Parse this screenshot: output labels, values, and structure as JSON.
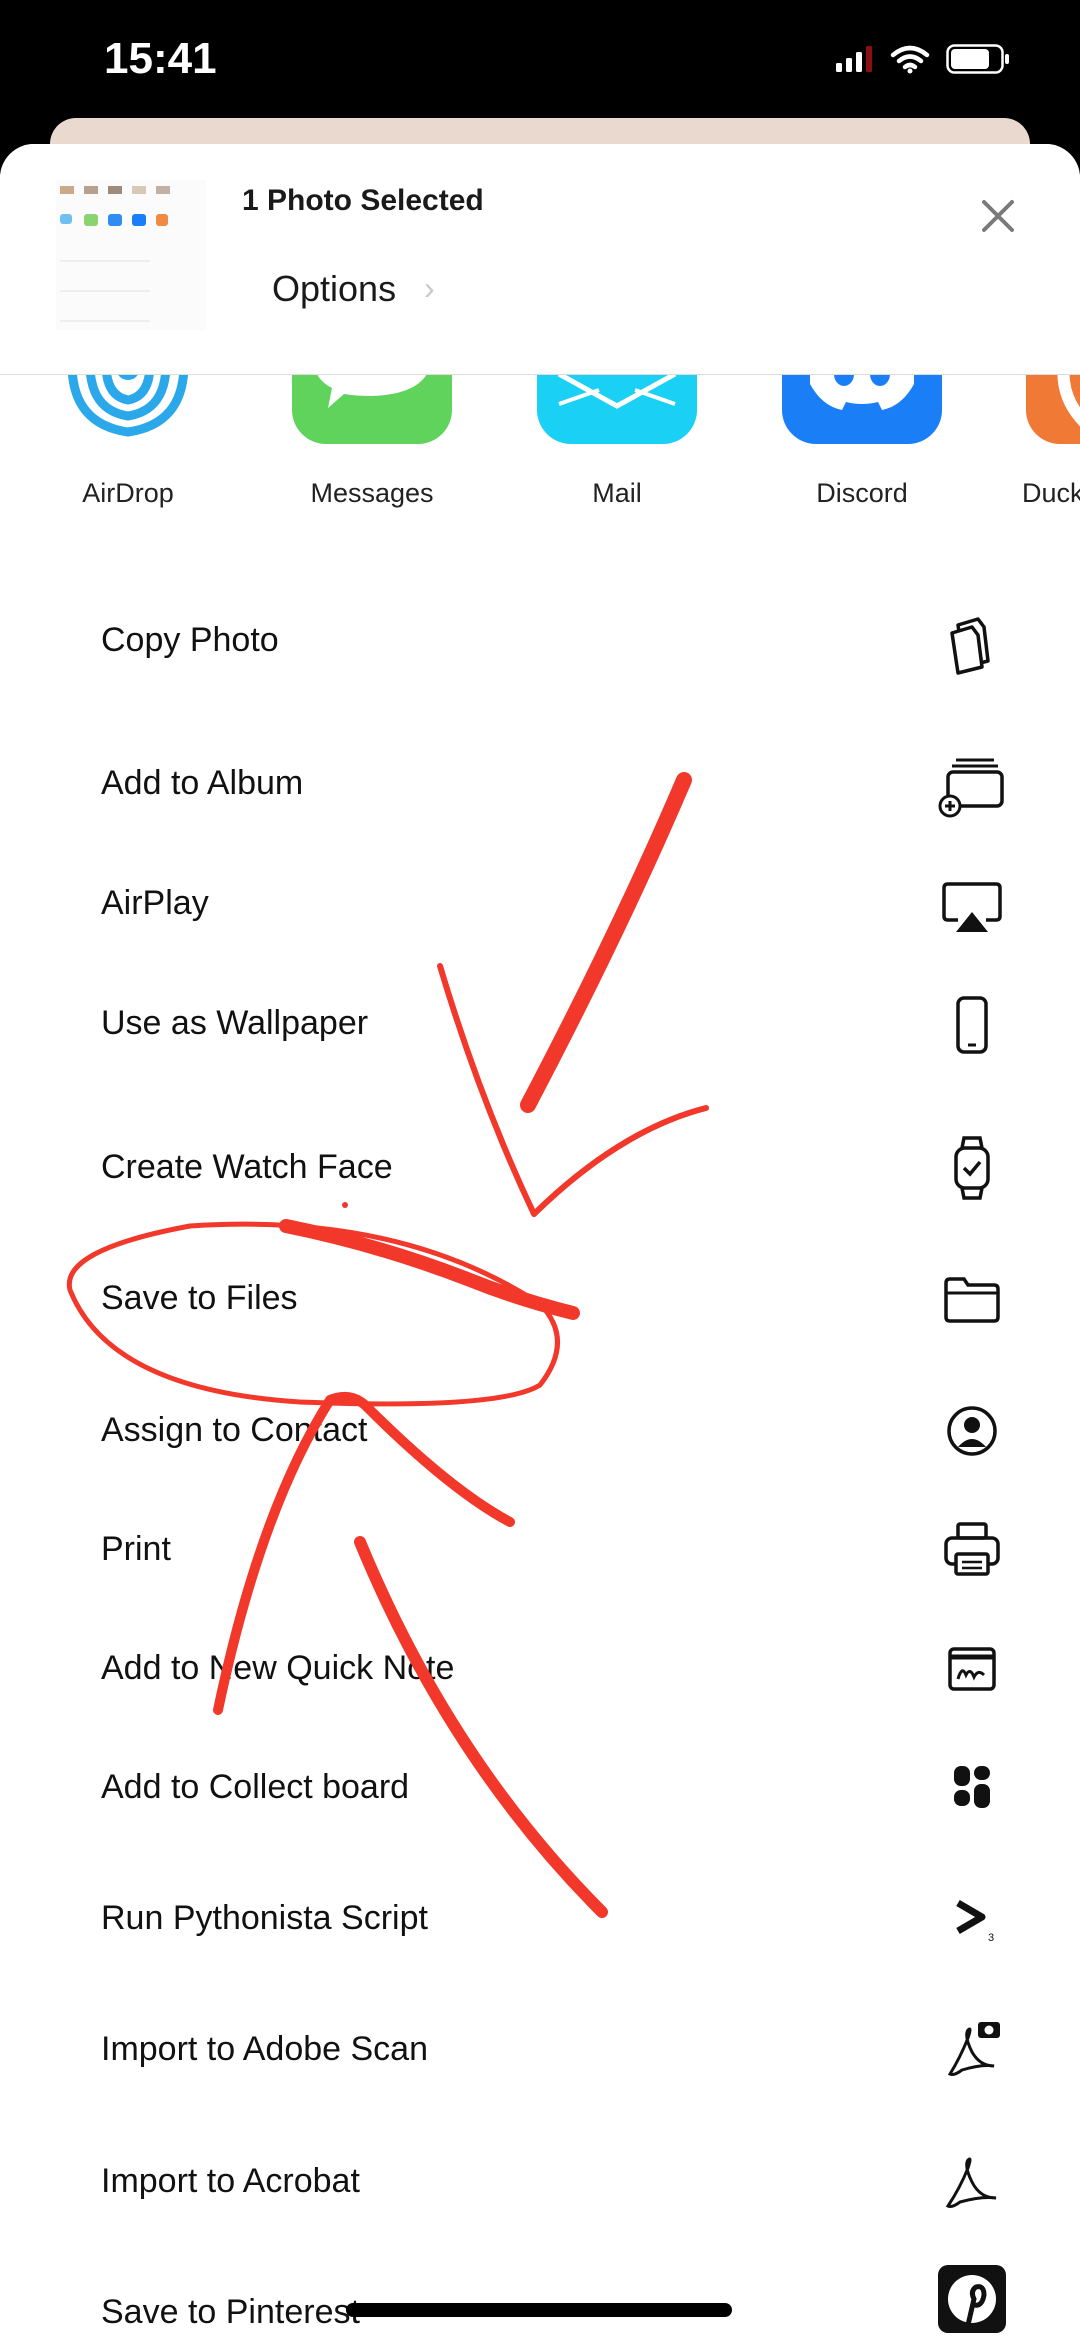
{
  "status_bar": {
    "time": "15:41"
  },
  "header": {
    "title": "1 Photo Selected",
    "options_label": "Options"
  },
  "apps": [
    {
      "label": "AirDrop",
      "icon": "airdrop-icon",
      "color": "#2aa8ea"
    },
    {
      "label": "Messages",
      "icon": "messages-icon",
      "color": "#5fd35b"
    },
    {
      "label": "Mail",
      "icon": "mail-icon",
      "color": "#1ad0f5"
    },
    {
      "label": "Discord",
      "icon": "discord-icon",
      "color": "#1a7ef7"
    },
    {
      "label": "Duck",
      "icon": "duckduckgo-icon",
      "color": "#f07a35"
    }
  ],
  "actions": [
    {
      "label": "Copy Photo",
      "icon": "copy-icon"
    },
    {
      "label": "Add to Album",
      "icon": "add-to-album-icon"
    },
    {
      "label": "AirPlay",
      "icon": "airplay-icon"
    },
    {
      "label": "Use as Wallpaper",
      "icon": "phone-icon"
    },
    {
      "label": "Create Watch Face",
      "icon": "watch-icon"
    },
    {
      "label": "Save to Files",
      "icon": "folder-icon"
    },
    {
      "label": "Assign to Contact",
      "icon": "contact-icon"
    },
    {
      "label": "Print",
      "icon": "printer-icon"
    },
    {
      "label": "Add to New Quick Note",
      "icon": "quick-note-icon"
    },
    {
      "label": "Add to Collect board",
      "icon": "collect-board-icon"
    },
    {
      "label": "Run Pythonista Script",
      "icon": "pythonista-icon"
    },
    {
      "label": "Import to Adobe Scan",
      "icon": "adobe-scan-icon"
    },
    {
      "label": "Import to Acrobat",
      "icon": "acrobat-icon"
    },
    {
      "label": "Save to Pinterest",
      "icon": "pinterest-icon"
    }
  ],
  "annotation_color": "#f1382a"
}
